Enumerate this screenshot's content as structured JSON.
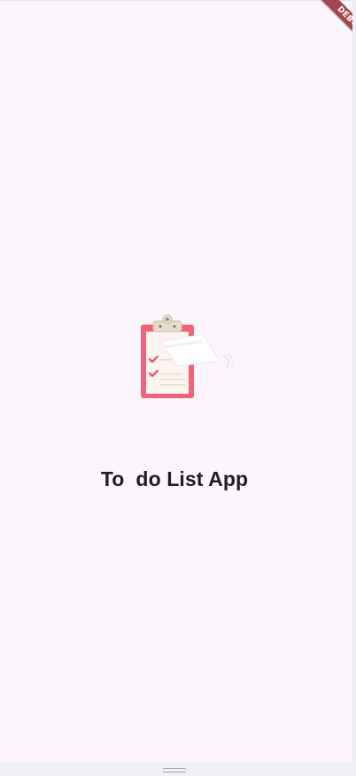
{
  "debug_banner": {
    "label": "DEBUG"
  },
  "splash": {
    "title": "To  do List App",
    "logo_icon": "clipboard-checklist-icon"
  },
  "colors": {
    "background": "#fcf5fc",
    "banner": "#a3464d",
    "clipboard": "#f0647a",
    "title_text": "#1f1d22"
  }
}
